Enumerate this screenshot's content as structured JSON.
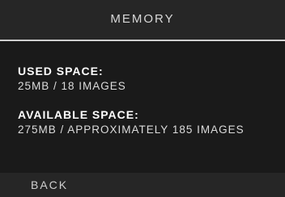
{
  "header": {
    "title": "MEMORY"
  },
  "used_space": {
    "label": "USED SPACE:",
    "value": "25MB / 18 IMAGES"
  },
  "available_space": {
    "label": "AVAILABLE SPACE:",
    "value": "275MB / APPROXIMATELY 185 IMAGES"
  },
  "footer": {
    "back_label": "BACK"
  },
  "colors": {
    "background": "#1a1a1a",
    "header_background": "#262626",
    "header_border": "#cfcfcf",
    "text": "#e8e8e8"
  }
}
